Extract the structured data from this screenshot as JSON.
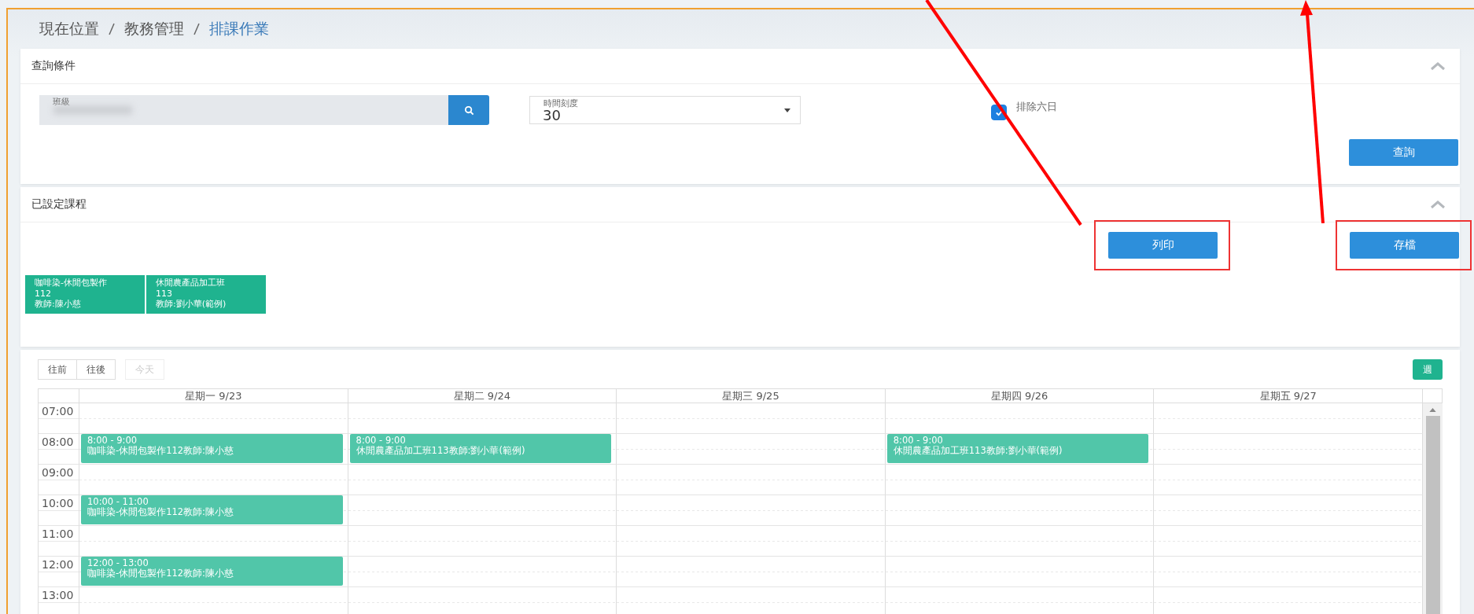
{
  "breadcrumb": [
    {
      "label": "現在位置",
      "current": false
    },
    {
      "label": "教務管理",
      "current": false
    },
    {
      "label": "排課作業",
      "current": true
    }
  ],
  "query_panel": {
    "title": "查詢條件",
    "expanded": true,
    "class_field": {
      "label": "班級"
    },
    "interval_field": {
      "label": "時間刻度",
      "value": "30"
    },
    "exclude_weekend": {
      "label": "排除六日",
      "checked": true
    },
    "query_button": "查詢"
  },
  "courses_panel": {
    "title": "已設定課程",
    "expanded": true,
    "buttons": [
      {
        "label": "列印",
        "highlighted": true
      },
      {
        "label": "存檔",
        "highlighted": true
      }
    ],
    "courses": [
      {
        "lines": [
          "咖啡染-休閒包製作",
          "112",
          "教師:陳小慈"
        ]
      },
      {
        "lines": [
          "休閒農產品加工班",
          "113",
          "教師:劉小華(範例)"
        ]
      }
    ]
  },
  "calendar": {
    "nav": [
      {
        "label": "往前",
        "disabled": false
      },
      {
        "label": "往後",
        "disabled": false
      }
    ],
    "today": {
      "label": "今天",
      "disabled": true
    },
    "view_button": "週",
    "days": [
      "星期一 9/23",
      "星期二 9/24",
      "星期三 9/25",
      "星期四 9/26",
      "星期五 9/27"
    ],
    "rows": [
      {
        "time": "07:00",
        "cells": [
          null,
          null,
          null,
          null,
          null
        ]
      },
      {
        "time": "08:00",
        "cells": [
          {
            "time": "8:00 - 9:00",
            "title": "咖啡染-休閒包製作112教師:陳小慈"
          },
          {
            "time": "8:00 - 9:00",
            "title": "休閒農產品加工班113教師:劉小華(範例)"
          },
          null,
          {
            "time": "8:00 - 9:00",
            "title": "休閒農產品加工班113教師:劉小華(範例)"
          },
          null
        ]
      },
      {
        "time": "09:00",
        "cells": [
          null,
          null,
          null,
          null,
          null
        ]
      },
      {
        "time": "10:00",
        "cells": [
          {
            "time": "10:00 - 11:00",
            "title": "咖啡染-休閒包製作112教師:陳小慈"
          },
          null,
          null,
          null,
          null
        ]
      },
      {
        "time": "11:00",
        "cells": [
          null,
          null,
          null,
          null,
          null
        ]
      },
      {
        "time": "12:00",
        "cells": [
          {
            "time": "12:00 - 13:00",
            "title": "咖啡染-休閒包製作112教師:陳小慈"
          },
          null,
          null,
          null,
          null
        ]
      },
      {
        "time": "13:00",
        "cells": [
          null,
          null,
          null,
          null,
          null
        ]
      }
    ]
  }
}
